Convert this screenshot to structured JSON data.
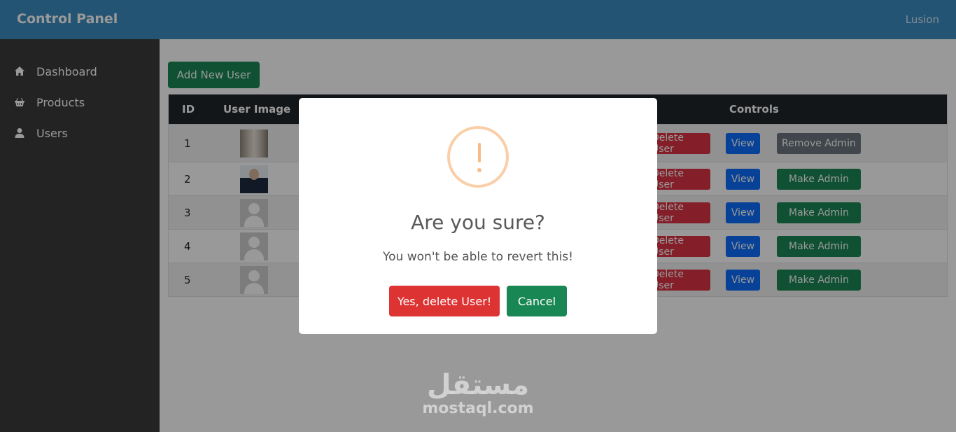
{
  "header": {
    "brand": "Control Panel",
    "user": "Lusion"
  },
  "sidebar": {
    "items": [
      {
        "label": "Dashboard",
        "icon": "home-icon"
      },
      {
        "label": "Products",
        "icon": "basket-icon"
      },
      {
        "label": "Users",
        "icon": "user-icon"
      }
    ]
  },
  "main": {
    "add_button": "Add New User"
  },
  "table": {
    "headers": {
      "id": "ID",
      "image": "User Image",
      "controls": "Controls"
    },
    "rows": [
      {
        "id": "1",
        "delete": "Delete User",
        "view": "View",
        "admin": "Remove Admin",
        "image": "photo-1"
      },
      {
        "id": "2",
        "delete": "Delete User",
        "view": "View",
        "admin": "Make Admin",
        "image": "photo-2"
      },
      {
        "id": "3",
        "delete": "Delete User",
        "view": "View",
        "admin": "Make Admin",
        "image": "placeholder"
      },
      {
        "id": "4",
        "delete": "Delete User",
        "view": "View",
        "admin": "Make Admin",
        "image": "placeholder"
      },
      {
        "id": "5",
        "delete": "Delete User",
        "view": "View",
        "admin": "Make Admin",
        "image": "placeholder"
      }
    ]
  },
  "modal": {
    "title": "Are you sure?",
    "text": "You won't be able to revert this!",
    "confirm": "Yes, delete User!",
    "cancel": "Cancel"
  },
  "watermark": {
    "arabic": "مستقل",
    "latin": "mostaql.com"
  },
  "colors": {
    "header": "#3d8cc1",
    "sidebar": "#3b3b3b",
    "success": "#198754",
    "danger": "#dc3545",
    "primary": "#0d6efd",
    "secondary": "#6c757d",
    "warning_icon": "#f8bb86"
  }
}
